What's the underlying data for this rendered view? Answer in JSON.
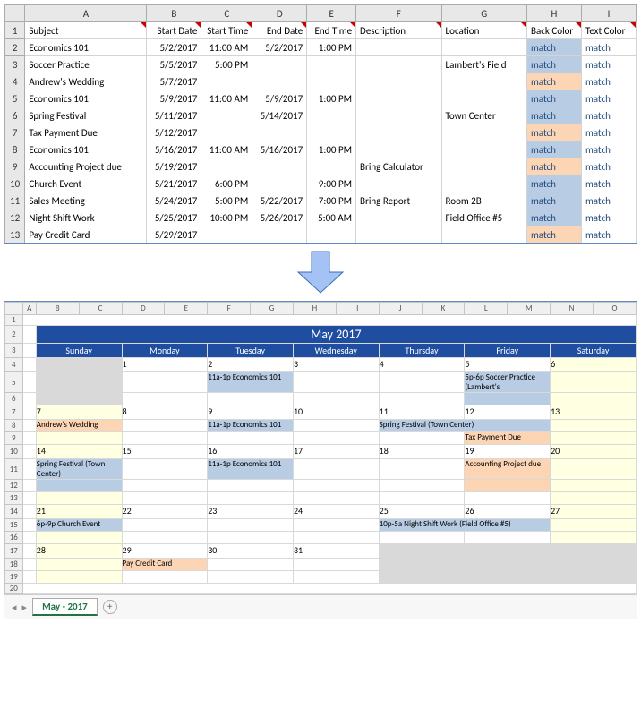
{
  "top": {
    "col_letters": [
      "",
      "A",
      "B",
      "C",
      "D",
      "E",
      "F",
      "G",
      "H",
      "I"
    ],
    "headers": [
      "Subject",
      "Start Date",
      "Start Time",
      "End Date",
      "End Time",
      "Description",
      "Location",
      "Back Color",
      "Text Color"
    ],
    "rows": [
      {
        "n": "2",
        "subject": "Economics 101",
        "sd": "5/2/2017",
        "st": "11:00 AM",
        "ed": "5/2/2017",
        "et": "1:00 PM",
        "desc": "",
        "loc": "",
        "bc": "blue",
        "tc": "match"
      },
      {
        "n": "3",
        "subject": "Soccer Practice",
        "sd": "5/5/2017",
        "st": "5:00 PM",
        "ed": "",
        "et": "",
        "desc": "",
        "loc": "Lambert's Field",
        "bc": "blue",
        "tc": "match"
      },
      {
        "n": "4",
        "subject": "Andrew's Wedding",
        "sd": "5/7/2017",
        "st": "",
        "ed": "",
        "et": "",
        "desc": "",
        "loc": "",
        "bc": "orange",
        "tc": "match"
      },
      {
        "n": "5",
        "subject": "Economics 101",
        "sd": "5/9/2017",
        "st": "11:00 AM",
        "ed": "5/9/2017",
        "et": "1:00 PM",
        "desc": "",
        "loc": "",
        "bc": "blue",
        "tc": "match"
      },
      {
        "n": "6",
        "subject": "Spring Festival",
        "sd": "5/11/2017",
        "st": "",
        "ed": "5/14/2017",
        "et": "",
        "desc": "",
        "loc": "Town Center",
        "bc": "blue",
        "tc": "match"
      },
      {
        "n": "7",
        "subject": "Tax Payment Due",
        "sd": "5/12/2017",
        "st": "",
        "ed": "",
        "et": "",
        "desc": "",
        "loc": "",
        "bc": "orange",
        "tc": "match"
      },
      {
        "n": "8",
        "subject": "Economics 101",
        "sd": "5/16/2017",
        "st": "11:00 AM",
        "ed": "5/16/2017",
        "et": "1:00 PM",
        "desc": "",
        "loc": "",
        "bc": "blue",
        "tc": "match"
      },
      {
        "n": "9",
        "subject": "Accounting Project due",
        "sd": "5/19/2017",
        "st": "",
        "ed": "",
        "et": "",
        "desc": "Bring Calculator",
        "loc": "",
        "bc": "orange",
        "tc": "match"
      },
      {
        "n": "10",
        "subject": "Church Event",
        "sd": "5/21/2017",
        "st": "6:00 PM",
        "ed": "",
        "et": "9:00 PM",
        "desc": "",
        "loc": "",
        "bc": "blue",
        "tc": "match"
      },
      {
        "n": "11",
        "subject": "Sales Meeting",
        "sd": "5/24/2017",
        "st": "5:00 PM",
        "ed": "5/22/2017",
        "et": "7:00 PM",
        "desc": "Bring Report",
        "loc": "Room 2B",
        "bc": "blue",
        "tc": "match"
      },
      {
        "n": "12",
        "subject": "Night Shift Work",
        "sd": "5/25/2017",
        "st": "10:00 PM",
        "ed": "5/26/2017",
        "et": "5:00 AM",
        "desc": "",
        "loc": "Field Office #5",
        "bc": "blue",
        "tc": "match"
      },
      {
        "n": "13",
        "subject": "Pay Credit Card",
        "sd": "5/29/2017",
        "st": "",
        "ed": "",
        "et": "",
        "desc": "",
        "loc": "",
        "bc": "orange",
        "tc": "match"
      }
    ],
    "match_label": "match"
  },
  "cal": {
    "col_letters": [
      "",
      "A",
      "B",
      "C",
      "D",
      "E",
      "F",
      "G",
      "H",
      "I",
      "J",
      "K",
      "L",
      "M",
      "N",
      "O"
    ],
    "title": "May 2017",
    "day_headers": [
      "Sunday",
      "Monday",
      "Tuesday",
      "Wednesday",
      "Thursday",
      "Friday",
      "Saturday"
    ],
    "weeks": [
      [
        {
          "num": "",
          "events": [],
          "outside": true
        },
        {
          "num": "1",
          "events": []
        },
        {
          "num": "2",
          "events": [
            {
              "text": "11a-1p Economics 101",
              "color": "blue"
            }
          ]
        },
        {
          "num": "3",
          "events": []
        },
        {
          "num": "4",
          "events": []
        },
        {
          "num": "5",
          "events": [
            {
              "text": "5p-6p Soccer Practice (Lambert's",
              "color": "blue",
              "rows": 2
            }
          ]
        },
        {
          "num": "6",
          "events": [],
          "weekend": true
        }
      ],
      [
        {
          "num": "7",
          "events": [
            {
              "text": "Andrew's Wedding",
              "color": "orange"
            }
          ],
          "weekend": true
        },
        {
          "num": "8",
          "events": []
        },
        {
          "num": "9",
          "events": [
            {
              "text": "11a-1p Economics 101",
              "color": "blue"
            }
          ]
        },
        {
          "num": "10",
          "events": []
        },
        {
          "num": "11",
          "events": [
            {
              "text": "Spring Festival (Town Center)",
              "color": "blue",
              "span": 2
            }
          ]
        },
        {
          "num": "12",
          "events": [
            {
              "text": "Tax Payment Due",
              "color": "orange"
            }
          ],
          "skip_first": true
        },
        {
          "num": "13",
          "events": [],
          "weekend": true
        }
      ],
      [
        {
          "num": "14",
          "events": [
            {
              "text": "Spring Festival (Town Center)",
              "color": "blue",
              "rows": 2
            }
          ],
          "weekend": true
        },
        {
          "num": "15",
          "events": []
        },
        {
          "num": "16",
          "events": [
            {
              "text": "11a-1p Economics 101",
              "color": "blue"
            }
          ]
        },
        {
          "num": "17",
          "events": []
        },
        {
          "num": "18",
          "events": []
        },
        {
          "num": "19",
          "events": [
            {
              "text": "Accounting Project due",
              "color": "orange",
              "rows": 2
            }
          ]
        },
        {
          "num": "20",
          "events": [],
          "weekend": true
        }
      ],
      [
        {
          "num": "21",
          "events": [
            {
              "text": "6p-9p Church Event",
              "color": "blue"
            }
          ],
          "weekend": true
        },
        {
          "num": "22",
          "events": []
        },
        {
          "num": "23",
          "events": []
        },
        {
          "num": "24",
          "events": []
        },
        {
          "num": "25",
          "events": [
            {
              "text": "10p-5a Night Shift Work (Field Office #5)",
              "color": "blue",
              "span": 2
            }
          ]
        },
        {
          "num": "26",
          "events": [],
          "skip_first": true
        },
        {
          "num": "27",
          "events": [],
          "weekend": true
        }
      ],
      [
        {
          "num": "28",
          "events": [],
          "weekend": true
        },
        {
          "num": "29",
          "events": [
            {
              "text": "Pay Credit Card",
              "color": "orange"
            }
          ]
        },
        {
          "num": "30",
          "events": []
        },
        {
          "num": "31",
          "events": []
        },
        {
          "num": "",
          "events": [],
          "outside": true
        },
        {
          "num": "",
          "events": [],
          "outside": true
        },
        {
          "num": "",
          "events": [],
          "outside": true
        }
      ]
    ]
  },
  "sheet_tab": "May - 2017"
}
